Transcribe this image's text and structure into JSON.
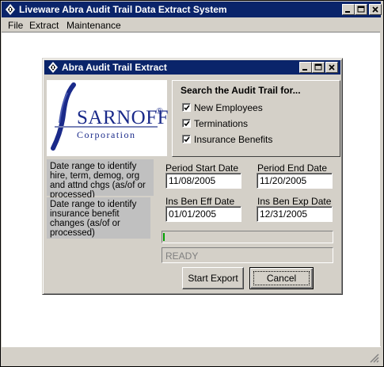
{
  "window": {
    "title": "Liveware Abra Audit Trail Data Extract System"
  },
  "menu": {
    "items": [
      "File",
      "Extract",
      "Maintenance"
    ]
  },
  "dialog": {
    "title": "Abra Audit Trail Extract",
    "logo": {
      "brand": "SARNOFF",
      "registered": "®",
      "subtitle": "Corporation"
    },
    "search": {
      "title": "Search the Audit Trail for...",
      "options": [
        {
          "label": "New Employees",
          "checked": true
        },
        {
          "label": "Terminations",
          "checked": true
        },
        {
          "label": "Insurance Benefits",
          "checked": true
        }
      ]
    },
    "notes": {
      "hire_range": "Date range to identify hire, term, demog, org and attnd chgs (as/of or processed)",
      "benefit_range": "Date range to identify insurance benefit changes (as/of or processed)"
    },
    "fields": {
      "period_start": {
        "label": "Period Start Date",
        "value": "11/08/2005"
      },
      "period_end": {
        "label": "Period End Date",
        "value": "11/20/2005"
      },
      "ins_ben_eff": {
        "label": "Ins Ben Eff Date",
        "value": "01/01/2005"
      },
      "ins_ben_exp": {
        "label": "Ins Ben Exp Date",
        "value": "12/31/2005"
      }
    },
    "progress": {
      "fraction": 0.01
    },
    "status_text": "READY",
    "buttons": {
      "start_export": "Start Export",
      "cancel": "Cancel"
    }
  },
  "colors": {
    "titlebar": "#0a246a",
    "face": "#d4d0c8",
    "note_bg": "#c0c0c0",
    "logo_blue": "#1a2a8a"
  }
}
